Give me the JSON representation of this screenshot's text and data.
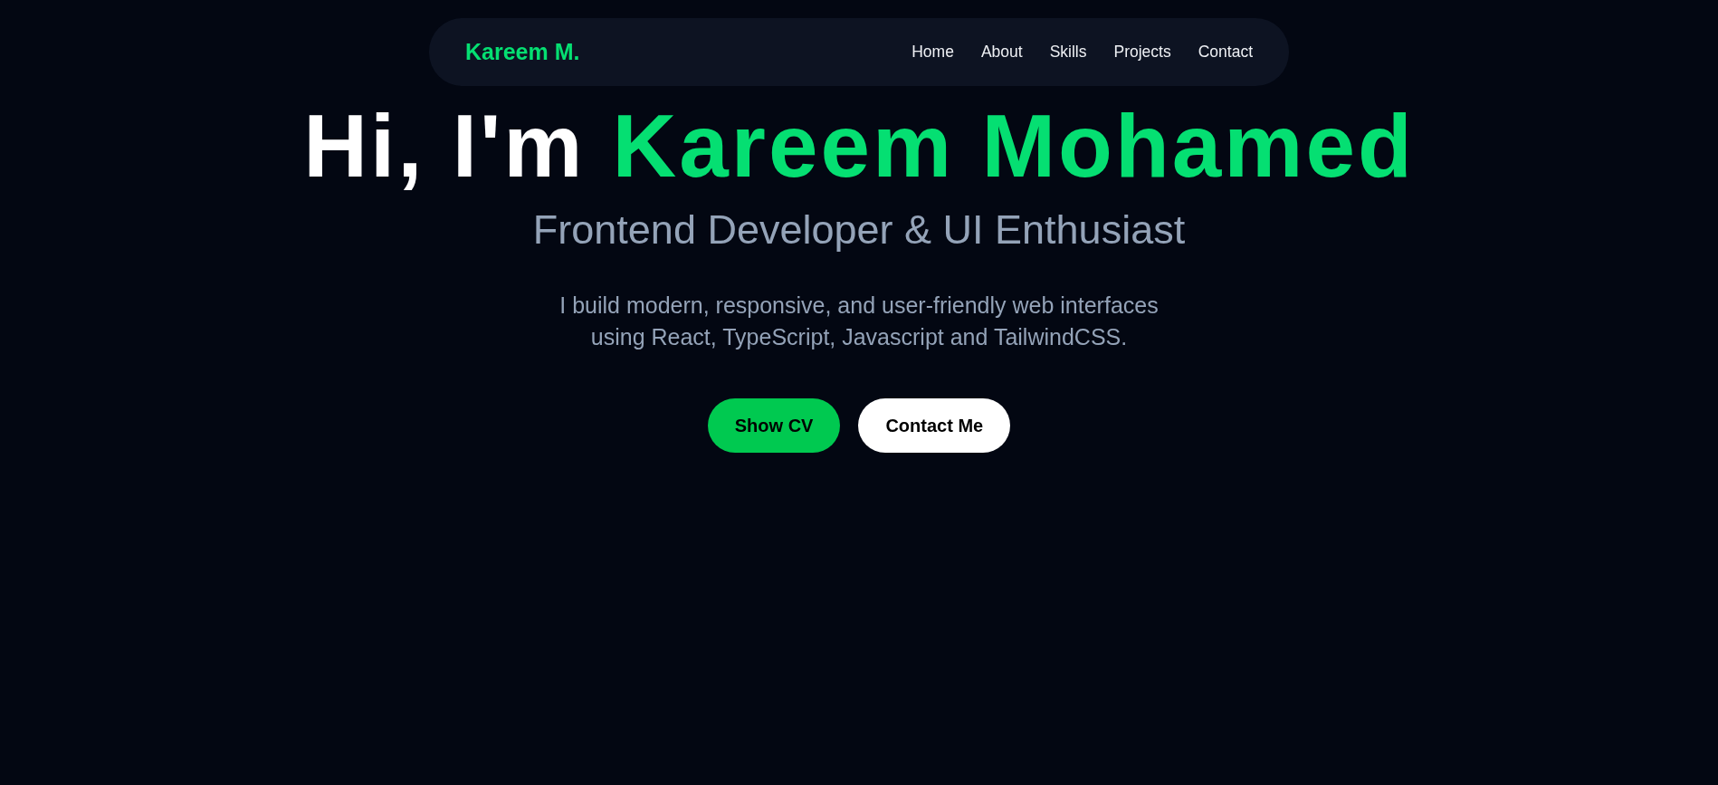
{
  "nav": {
    "logo": "Kareem M.",
    "links": [
      {
        "label": "Home"
      },
      {
        "label": "About"
      },
      {
        "label": "Skills"
      },
      {
        "label": "Projects"
      },
      {
        "label": "Contact"
      }
    ]
  },
  "hero": {
    "heading": {
      "text": "Hi, I'm",
      "highlight": "Kareem Mohamed"
    },
    "subtitle": "Frontend Developer & UI Enthusiast",
    "description": "I build modern, responsive, and user-friendly web interfaces using React, TypeScript, Javascript and TailwindCSS.",
    "buttons": [
      {
        "label": "Show CV",
        "kind": "primary"
      },
      {
        "label": "Contact Me",
        "kind": "secondary"
      }
    ]
  }
}
